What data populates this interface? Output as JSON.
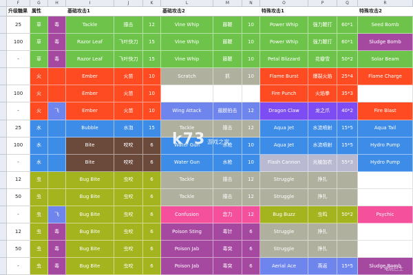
{
  "columns": [
    "F",
    "G",
    "H",
    "I",
    "J",
    "K",
    "L",
    "M",
    "N",
    "O",
    "P",
    "Q",
    "R"
  ],
  "groups": {
    "level": "升级糖果",
    "type": "属性",
    "basic1": "基础攻击1",
    "basic2": "基础攻击2",
    "special1": "特殊攻击1",
    "special2": "特殊攻击2"
  },
  "colors": {
    "grass": "#6ec44b",
    "poison": "#a548a0",
    "fire": "#ff4b21",
    "flying": "#6e85ee",
    "water": "#3d8ce8",
    "normal": "#afb09e",
    "dark": "#6b4a3b",
    "bug": "#a4b41e",
    "psychic": "#f4509c",
    "steel": "#b9b9d1",
    "dragon": "#7d4cf2",
    "blank": "#ffffff"
  },
  "rows": [
    {
      "level": "25",
      "t1": {
        "text": "草",
        "c": "grass"
      },
      "t2": {
        "text": "毒",
        "c": "poison"
      },
      "b1": {
        "en": "Tackle",
        "cn": "撞击",
        "pw": "12",
        "c": "grass"
      },
      "b2": {
        "en": "Vine Whip",
        "cn": "藤鞭",
        "pw": "10",
        "c": "grass"
      },
      "s1": {
        "en": "Power Whip",
        "cn": "强力鞭打",
        "pw": "60*1",
        "c": "grass"
      },
      "s2": {
        "en": "Seed Bomb",
        "c": "grass"
      }
    },
    {
      "level": "100",
      "t1": {
        "text": "草",
        "c": "grass"
      },
      "t2": {
        "text": "毒",
        "c": "poison"
      },
      "b1": {
        "en": "Razor Leaf",
        "cn": "飞叶快刀",
        "pw": "15",
        "c": "grass"
      },
      "b2": {
        "en": "Vine Whip",
        "cn": "藤鞭",
        "pw": "10",
        "c": "grass"
      },
      "s1": {
        "en": "Power Whip",
        "cn": "强力鞭打",
        "pw": "60*1",
        "c": "grass"
      },
      "s2": {
        "en": "Sludge Bomb",
        "c": "poison"
      }
    },
    {
      "level": "-",
      "t1": {
        "text": "草",
        "c": "grass"
      },
      "t2": {
        "text": "毒",
        "c": "poison"
      },
      "b1": {
        "en": "Razor Leaf",
        "cn": "飞叶快刀",
        "pw": "15",
        "c": "grass"
      },
      "b2": {
        "en": "Vine Whip",
        "cn": "藤鞭",
        "pw": "10",
        "c": "grass"
      },
      "s1": {
        "en": "Petal Blizzard",
        "cn": "花瓣雪",
        "pw": "50*2",
        "c": "grass"
      },
      "s2": {
        "en": "Solar Beam",
        "c": "grass"
      }
    },
    {
      "level": "",
      "t1": {
        "text": "火",
        "c": "fire"
      },
      "t2": {
        "text": "",
        "c": "fire"
      },
      "b1": {
        "en": "Ember",
        "cn": "火苗",
        "pw": "10",
        "c": "fire"
      },
      "b2": {
        "en": "Scratch",
        "cn": "抓",
        "pw": "10",
        "c": "normal"
      },
      "s1": {
        "en": "Flame Burst",
        "cn": "爆裂火焰",
        "pw": "25*4",
        "c": "fire"
      },
      "s2": {
        "en": "Flame Charge",
        "c": "fire"
      }
    },
    {
      "level": "100",
      "t1": {
        "text": "火",
        "c": "fire"
      },
      "t2": {
        "text": "",
        "c": "fire"
      },
      "b1": {
        "en": "Ember",
        "cn": "火苗",
        "pw": "10",
        "c": "fire"
      },
      "b2": {
        "en": "",
        "cn": "",
        "pw": "",
        "c": "blank"
      },
      "s1": {
        "en": "Fire Punch",
        "cn": "火焰拳",
        "pw": "35*3",
        "c": "fire"
      },
      "s2": {
        "en": "",
        "c": "blank"
      }
    },
    {
      "level": "-",
      "t1": {
        "text": "火",
        "c": "fire"
      },
      "t2": {
        "text": "飞",
        "c": "flying"
      },
      "b1": {
        "en": "Ember",
        "cn": "火苗",
        "pw": "10",
        "c": "fire"
      },
      "b2": {
        "en": "Wing Attack",
        "cn": "翅膀拍击",
        "pw": "12",
        "c": "flying"
      },
      "s1": {
        "en": "Dragon Claw",
        "cn": "龙之爪",
        "pw": "40*2",
        "c": "dragon"
      },
      "s2": {
        "en": "Fire Blast",
        "c": "fire"
      }
    },
    {
      "level": "25",
      "t1": {
        "text": "水",
        "c": "water"
      },
      "t2": {
        "text": "",
        "c": "water"
      },
      "b1": {
        "en": "Bubble",
        "cn": "水泡",
        "pw": "15",
        "c": "water"
      },
      "b2": {
        "en": "Tackle",
        "cn": "撞击",
        "pw": "12",
        "c": "normal"
      },
      "s1": {
        "en": "Aqua Jet",
        "cn": "水流喷射",
        "pw": "15*5",
        "c": "water"
      },
      "s2": {
        "en": "Aqua Tail",
        "c": "water"
      }
    },
    {
      "level": "100",
      "t1": {
        "text": "水",
        "c": "water"
      },
      "t2": {
        "text": "",
        "c": "water"
      },
      "b1": {
        "en": "Bite",
        "cn": "咬咬",
        "pw": "6",
        "c": "dark"
      },
      "b2": {
        "en": "Water Gun",
        "cn": "水枪",
        "pw": "10",
        "c": "water"
      },
      "s1": {
        "en": "Aqua Jet",
        "cn": "水流喷射",
        "pw": "15*5",
        "c": "water"
      },
      "s2": {
        "en": "Hydro Pump",
        "c": "water"
      }
    },
    {
      "level": "-",
      "t1": {
        "text": "水",
        "c": "water"
      },
      "t2": {
        "text": "",
        "c": "water"
      },
      "b1": {
        "en": "Bite",
        "cn": "咬咬",
        "pw": "6",
        "c": "dark"
      },
      "b2": {
        "en": "Water Gun",
        "cn": "水枪",
        "pw": "10",
        "c": "water"
      },
      "s1": {
        "en": "Flash Cannon",
        "cn": "光棱加农",
        "pw": "55*3",
        "c": "steel"
      },
      "s2": {
        "en": "Hydro Pump",
        "c": "water"
      }
    },
    {
      "level": "12",
      "t1": {
        "text": "虫",
        "c": "bug"
      },
      "t2": {
        "text": "",
        "c": "bug"
      },
      "b1": {
        "en": "Bug Bite",
        "cn": "虫咬",
        "pw": "6",
        "c": "bug"
      },
      "b2": {
        "en": "Tackle",
        "cn": "撞击",
        "pw": "12",
        "c": "normal"
      },
      "s1": {
        "en": "Struggle",
        "cn": "挣扎",
        "pw": "",
        "c": "normal"
      },
      "s2": {
        "en": "",
        "c": "blank"
      }
    },
    {
      "level": "50",
      "t1": {
        "text": "虫",
        "c": "bug"
      },
      "t2": {
        "text": "",
        "c": "bug"
      },
      "b1": {
        "en": "Bug Bite",
        "cn": "虫咬",
        "pw": "6",
        "c": "bug"
      },
      "b2": {
        "en": "Tackle",
        "cn": "撞击",
        "pw": "12",
        "c": "normal"
      },
      "s1": {
        "en": "Struggle",
        "cn": "挣扎",
        "pw": "",
        "c": "normal"
      },
      "s2": {
        "en": "",
        "c": "blank"
      }
    },
    {
      "level": "-",
      "t1": {
        "text": "虫",
        "c": "bug"
      },
      "t2": {
        "text": "飞",
        "c": "flying"
      },
      "b1": {
        "en": "Bug Bite",
        "cn": "虫咬",
        "pw": "6",
        "c": "bug"
      },
      "b2": {
        "en": "Confusion",
        "cn": "念力",
        "pw": "12",
        "c": "psychic"
      },
      "s1": {
        "en": "Bug Buzz",
        "cn": "虫鸣",
        "pw": "50*2",
        "c": "bug"
      },
      "s2": {
        "en": "Psychic",
        "c": "psychic"
      }
    },
    {
      "level": "12",
      "t1": {
        "text": "虫",
        "c": "bug"
      },
      "t2": {
        "text": "毒",
        "c": "poison"
      },
      "b1": {
        "en": "Bug Bite",
        "cn": "虫咬",
        "pw": "6",
        "c": "bug"
      },
      "b2": {
        "en": "Poison Sting",
        "cn": "毒针",
        "pw": "6",
        "c": "poison"
      },
      "s1": {
        "en": "Struggle",
        "cn": "挣扎",
        "pw": "",
        "c": "normal"
      },
      "s2": {
        "en": "",
        "c": "blank"
      }
    },
    {
      "level": "50",
      "t1": {
        "text": "虫",
        "c": "bug"
      },
      "t2": {
        "text": "毒",
        "c": "poison"
      },
      "b1": {
        "en": "Bug Bite",
        "cn": "虫咬",
        "pw": "6",
        "c": "bug"
      },
      "b2": {
        "en": "Poison Jab",
        "cn": "毒突",
        "pw": "6",
        "c": "poison"
      },
      "s1": {
        "en": "Struggle",
        "cn": "挣扎",
        "pw": "",
        "c": "normal"
      },
      "s2": {
        "en": "",
        "c": "blank"
      }
    },
    {
      "level": "-",
      "t1": {
        "text": "虫",
        "c": "bug"
      },
      "t2": {
        "text": "毒",
        "c": "poison"
      },
      "b1": {
        "en": "Bug Bite",
        "cn": "虫咬",
        "pw": "6",
        "c": "bug"
      },
      "b2": {
        "en": "Poison Jab",
        "cn": "毒突",
        "pw": "6",
        "c": "poison"
      },
      "s1": {
        "en": "Aerial Ace",
        "cn": "燕返",
        "pw": "15*5",
        "c": "flying"
      },
      "s2": {
        "en": "Sludge Bomb",
        "c": "poison"
      }
    }
  ],
  "watermark": {
    "logo": "k73",
    "cn": "游戏之家",
    "small": "电玩巴士"
  }
}
